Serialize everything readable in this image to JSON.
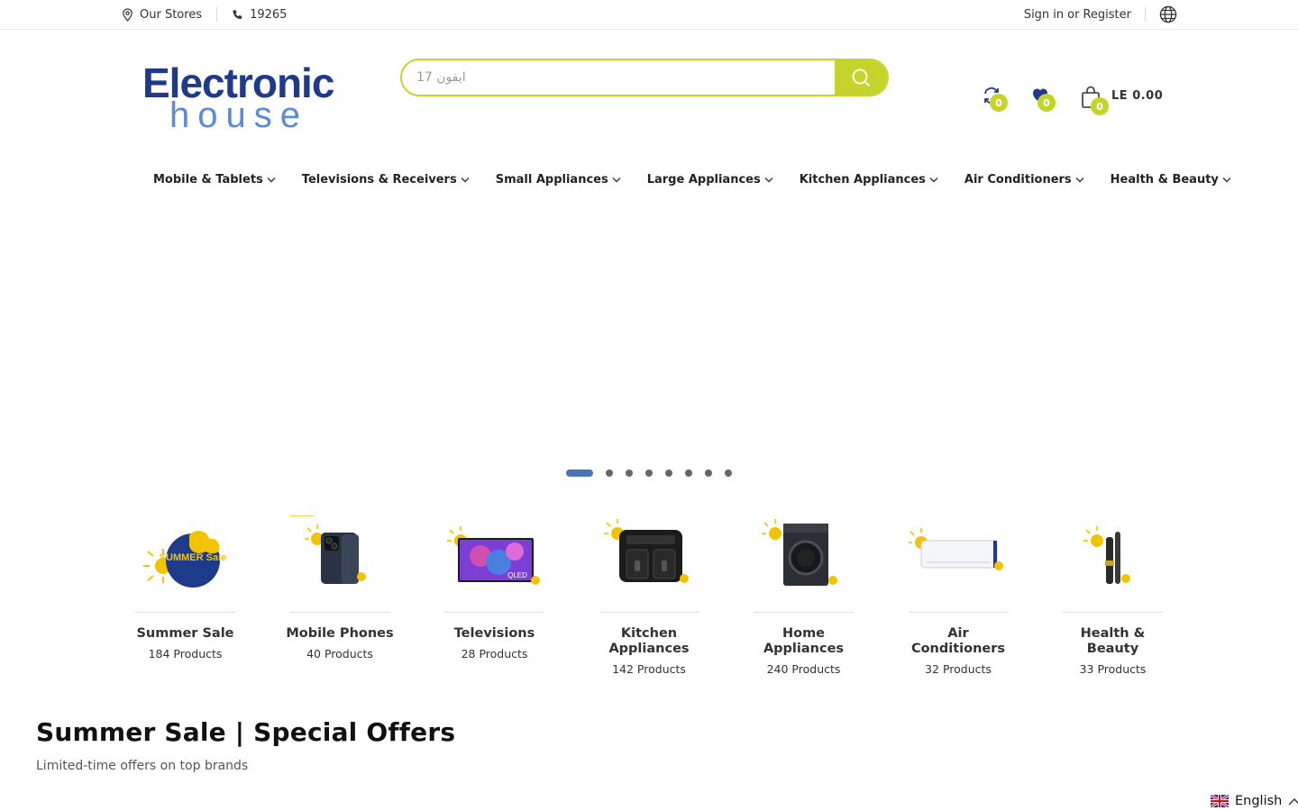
{
  "topbar": {
    "stores_label": "Our Stores",
    "phone_label": "19265",
    "sign_in_label": "Sign in",
    "or_label": "or",
    "register_label": "Register"
  },
  "header": {
    "logo_line1": "Electronic",
    "logo_line2": "house",
    "search_placeholder": "ايفون 17",
    "compare_count": "0",
    "wishlist_count": "0",
    "cart_count": "0",
    "cart_total": "LE 0.00"
  },
  "nav": {
    "items": [
      {
        "label": "Mobile & Tablets"
      },
      {
        "label": "Televisions & Receivers"
      },
      {
        "label": "Small Appliances"
      },
      {
        "label": "Large Appliances"
      },
      {
        "label": "Kitchen Appliances"
      },
      {
        "label": "Air Conditioners"
      },
      {
        "label": "Health & Beauty"
      }
    ]
  },
  "slider": {
    "slide_count": 8,
    "active_index": 0
  },
  "categories": [
    {
      "title": "Summer Sale",
      "count": "184 Products",
      "image_text": "SUMMER Sale"
    },
    {
      "title": "Mobile Phones",
      "count": "40 Products"
    },
    {
      "title": "Televisions",
      "count": "28 Products",
      "image_text": "QLED"
    },
    {
      "title": "Kitchen Appliances",
      "count": "142 Products"
    },
    {
      "title": "Home Appliances",
      "count": "240 Products"
    },
    {
      "title": "Air Conditioners",
      "count": "32 Products"
    },
    {
      "title": "Health & Beauty",
      "count": "33 Products"
    }
  ],
  "section": {
    "title": "Summer Sale | Special Offers",
    "subtitle": "Limited-time offers on top brands"
  },
  "language": {
    "label": "English"
  },
  "colors": {
    "accent": "#c5d42a",
    "brand_blue": "#1e3a8a",
    "brand_light_blue": "#5b8ad6",
    "slider_active": "#4a74b8"
  }
}
